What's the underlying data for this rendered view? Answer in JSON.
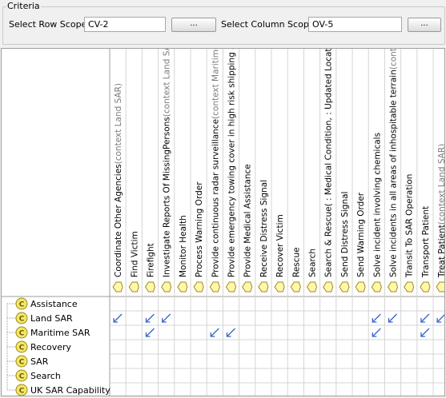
{
  "criteria": {
    "title": "Criteria",
    "row_scope_label": "Select Row Scope:",
    "row_scope_value": "CV-2",
    "row_button": "...",
    "col_scope_label": "Select Column Scope:",
    "col_scope_value": "OV-5",
    "col_button": "..."
  },
  "columns": [
    {
      "name": "Coordinate Other Agencies",
      "context": "(context Land SAR)"
    },
    {
      "name": "Find Victim",
      "context": ""
    },
    {
      "name": "Firefight",
      "context": ""
    },
    {
      "name": "Investigate Reports Of MissingPersons",
      "context": "(context Land SAR)"
    },
    {
      "name": "Monitor Health",
      "context": ""
    },
    {
      "name": "Process Warning Order",
      "context": ""
    },
    {
      "name": "Provide continuous radar surveillance",
      "context": "(context Maritime SAR)"
    },
    {
      "name": "Provide emergency towing cover in high risk shipping area...",
      "context": ""
    },
    {
      "name": "Provide Medical Assistance",
      "context": ""
    },
    {
      "name": "Receive Distress Signal",
      "context": ""
    },
    {
      "name": "Recover Victim",
      "context": ""
    },
    {
      "name": "Rescue",
      "context": ""
    },
    {
      "name": "Search",
      "context": ""
    },
    {
      "name": "Search & Rescue( : Medical Condition, : Updated Location )",
      "context": ""
    },
    {
      "name": "Send Distress Signal",
      "context": ""
    },
    {
      "name": "Send Warning Order",
      "context": ""
    },
    {
      "name": "Solve incident involving chemicals",
      "context": ""
    },
    {
      "name": "Solve incidents in all areas of inhospitable terrain",
      "context": "(context ..."
    },
    {
      "name": "Transit To SAR Operation",
      "context": ""
    },
    {
      "name": "Transport Patient",
      "context": ""
    },
    {
      "name": "Treat Patient",
      "context": "(context Land SAR)"
    }
  ],
  "rows": [
    {
      "name": "Assistance",
      "icon": "C"
    },
    {
      "name": "Land SAR",
      "icon": "C"
    },
    {
      "name": "Maritime SAR",
      "icon": "C"
    },
    {
      "name": "Recovery",
      "icon": "C"
    },
    {
      "name": "SAR",
      "icon": "C"
    },
    {
      "name": "Search",
      "icon": "C"
    },
    {
      "name": "UK SAR Capability",
      "icon": "C"
    }
  ],
  "dependencies": [
    {
      "row": 1,
      "col": 0
    },
    {
      "row": 1,
      "col": 2
    },
    {
      "row": 1,
      "col": 3
    },
    {
      "row": 1,
      "col": 16
    },
    {
      "row": 1,
      "col": 17
    },
    {
      "row": 1,
      "col": 19
    },
    {
      "row": 1,
      "col": 20
    },
    {
      "row": 2,
      "col": 2
    },
    {
      "row": 2,
      "col": 6
    },
    {
      "row": 2,
      "col": 7
    },
    {
      "row": 2,
      "col": 16
    },
    {
      "row": 2,
      "col": 19
    }
  ],
  "colors": {
    "arrow": "#3a62c8",
    "class_icon_fill": "#f2e66a",
    "class_icon_border": "#a08a10",
    "op_icon_fill": "#fff7b0",
    "op_icon_border": "#a08a10",
    "gridline": "#d4d4d4",
    "context_text": "#7a7a7a"
  }
}
